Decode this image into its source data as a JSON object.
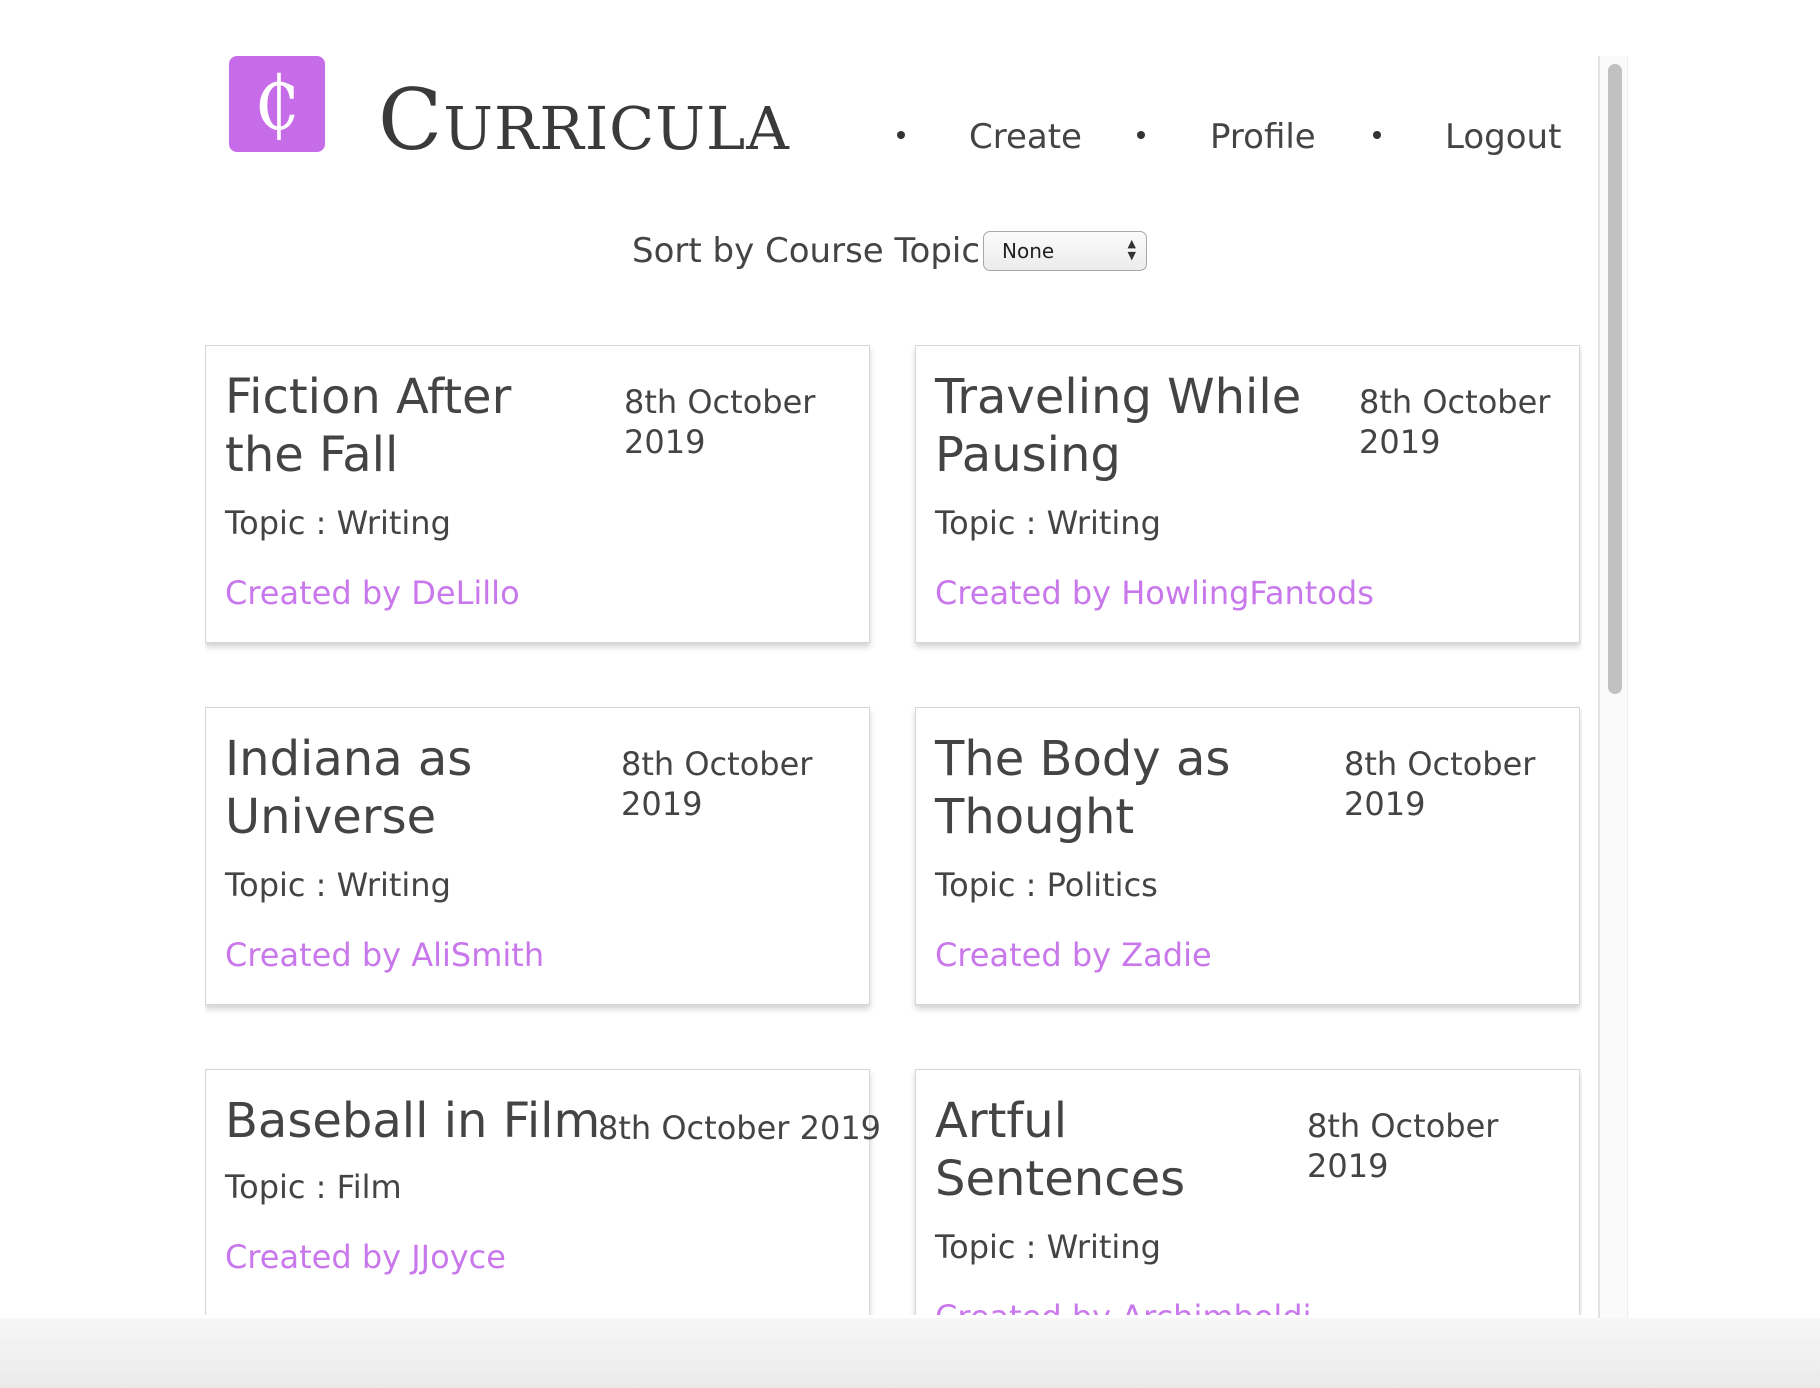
{
  "header": {
    "logo_glyph": "₵",
    "brand": "Curricula",
    "nav": [
      {
        "label": "Create"
      },
      {
        "label": "Profile"
      },
      {
        "label": "Logout"
      }
    ]
  },
  "sort": {
    "label": "Sort by Course Topic:",
    "selected": "None"
  },
  "courses": [
    {
      "title": "Fiction After the Fall",
      "date": "8th October 2019",
      "topic": "Topic : Writing",
      "creator": "Created by DeLillo"
    },
    {
      "title": "Traveling While Pausing",
      "date": "8th October 2019",
      "topic": "Topic : Writing",
      "creator": "Created by HowlingFantods"
    },
    {
      "title": "Indiana as Universe",
      "date": "8th October 2019",
      "topic": "Topic : Writing",
      "creator": "Created by AliSmith"
    },
    {
      "title": "The Body as Thought",
      "date": "8th October 2019",
      "topic": "Topic : Politics",
      "creator": "Created by Zadie"
    },
    {
      "title": "Baseball in Film",
      "date": "8th October 2019",
      "topic": "Topic : Film",
      "creator": "Created by JJoyce"
    },
    {
      "title": "Artful Sentences",
      "date": "8th October 2019",
      "topic": "Topic : Writing",
      "creator": "Created by Archimboldi"
    }
  ],
  "colors": {
    "accent": "#c66ce8",
    "link": "#c978ec",
    "text": "#444444"
  }
}
